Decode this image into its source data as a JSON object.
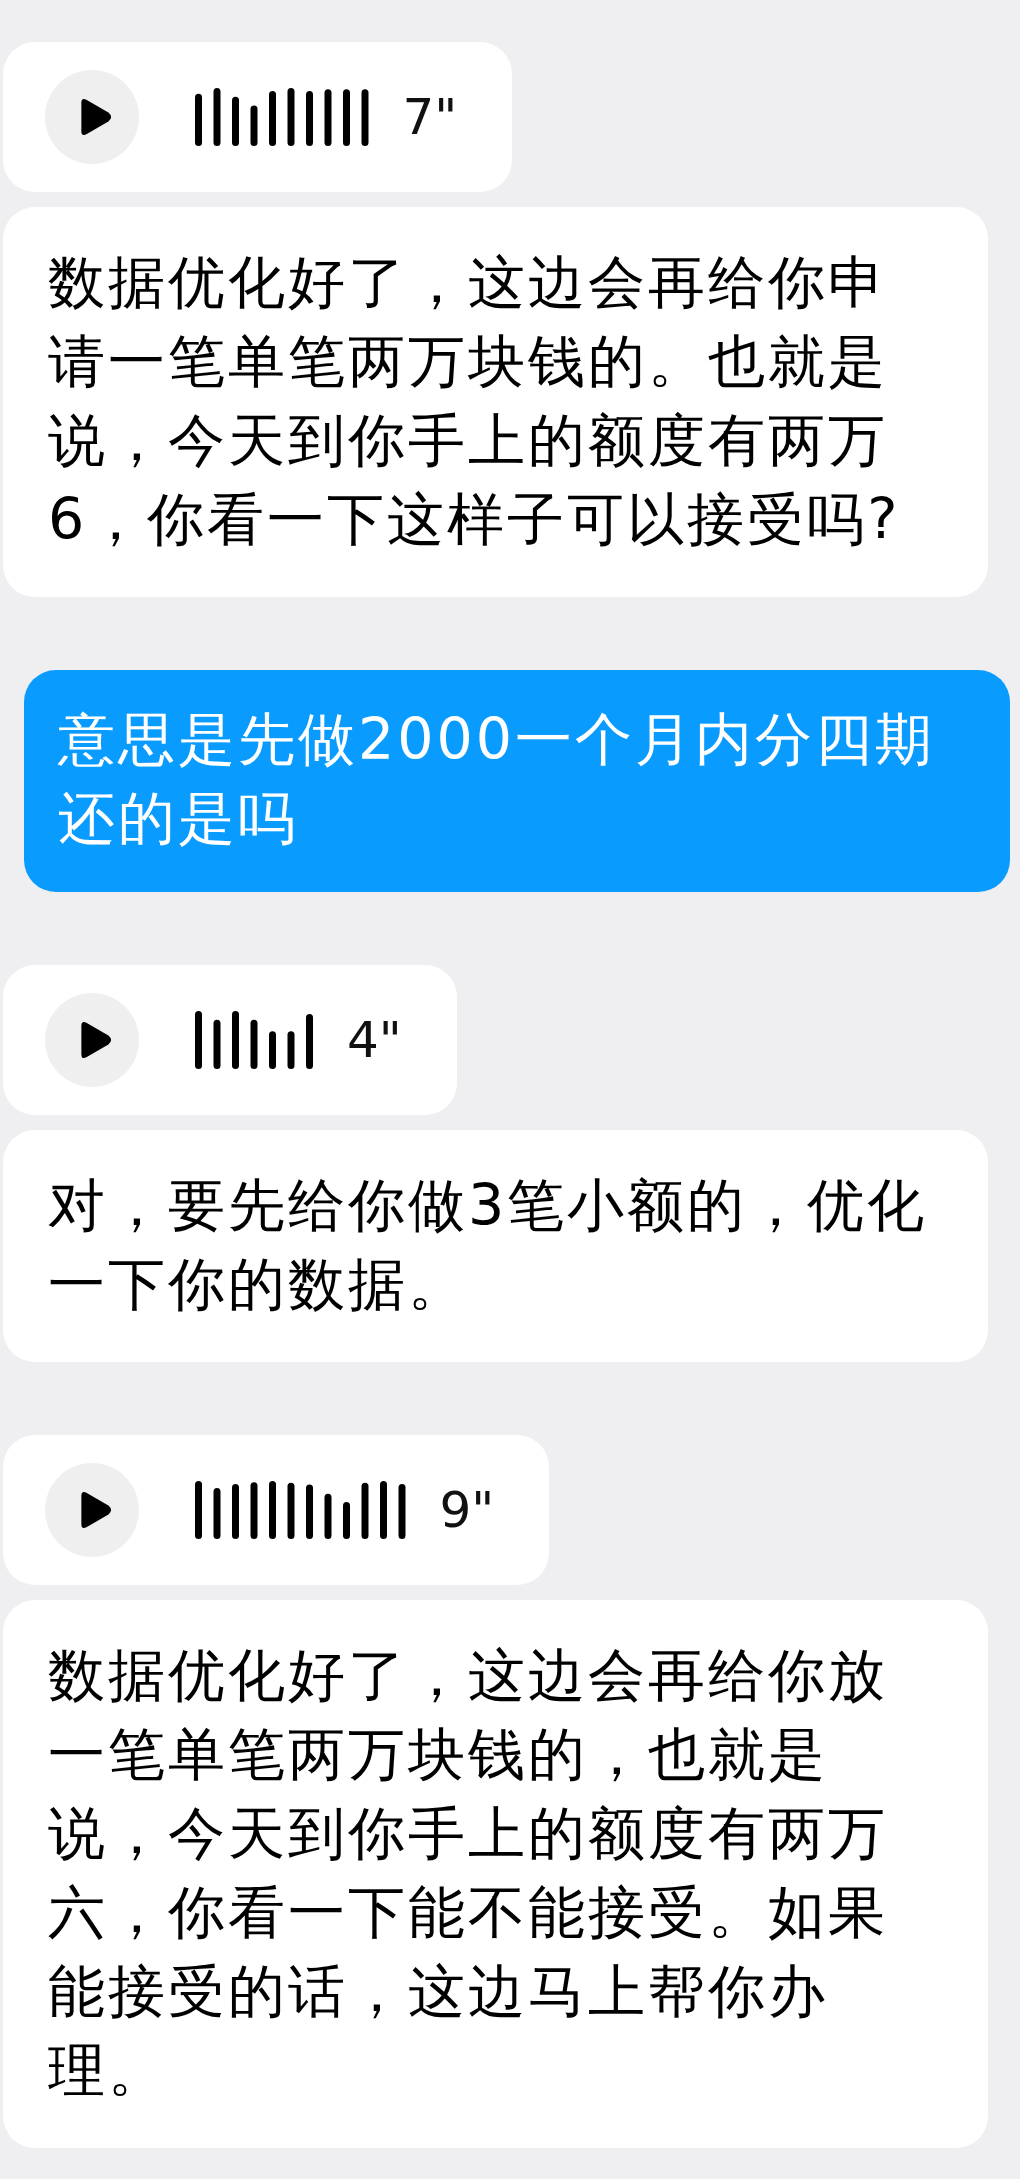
{
  "messages": [
    {
      "kind": "voice",
      "outgoing": false,
      "duration": "7\""
    },
    {
      "kind": "text",
      "outgoing": false,
      "text": "数据优化好了，这边会再给你申请一笔单笔两万块钱的。也就是说，今天到你手上的额度有两万6，你看一下这样子可以接受吗?"
    },
    {
      "kind": "text",
      "outgoing": true,
      "text": "意思是先做2000一个月内分四期还的是吗"
    },
    {
      "kind": "voice",
      "outgoing": false,
      "duration": "4\""
    },
    {
      "kind": "text",
      "outgoing": false,
      "text": "对，要先给你做3笔小额的，优化一下你的数据。"
    },
    {
      "kind": "voice",
      "outgoing": false,
      "duration": "9\""
    },
    {
      "kind": "text",
      "outgoing": false,
      "text": "数据优化好了，这边会再给你放一笔单笔两万块钱的，也就是说，今天到你手上的额度有两万六，你看一下能不能接受。如果能接受的话，这边马上帮你办理。"
    }
  ]
}
